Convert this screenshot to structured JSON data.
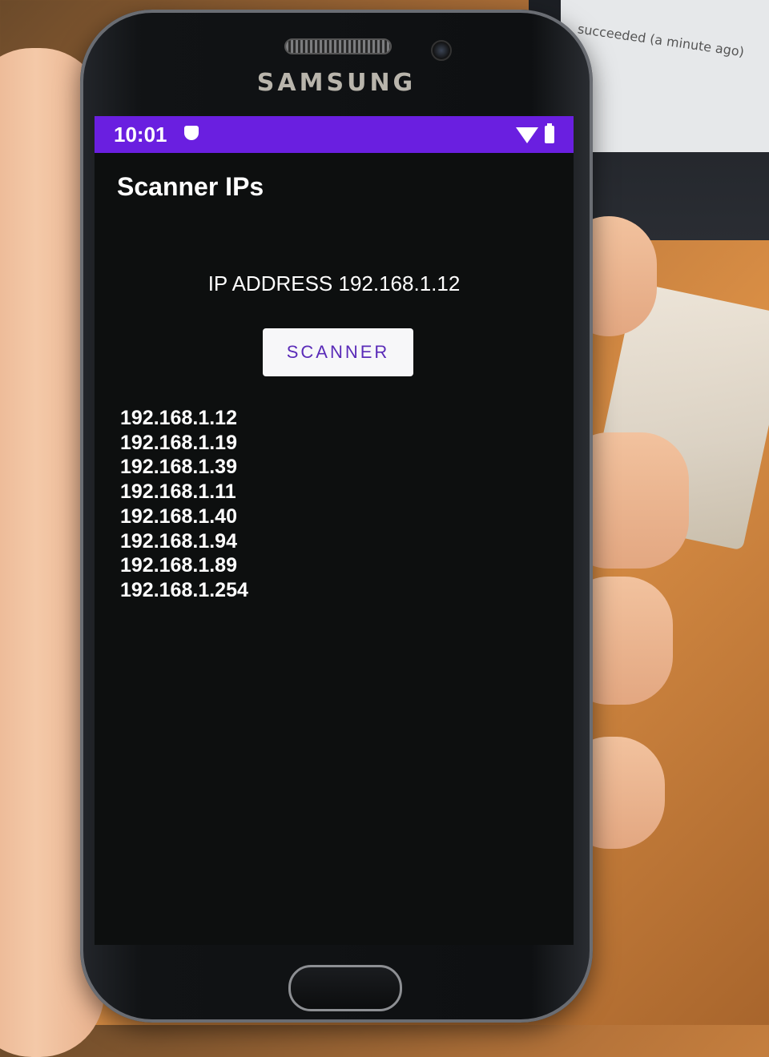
{
  "device": {
    "brand": "SAMSUNG"
  },
  "status_bar": {
    "time": "10:01",
    "accent_color": "#6a1fe0"
  },
  "app": {
    "title": "Scanner IPs",
    "ip_address_line": "IP ADDRESS 192.168.1.12",
    "scan_button_label": "SCANNER",
    "found_ips": [
      "192.168.1.12",
      "192.168.1.19",
      "192.168.1.39",
      "192.168.1.11",
      "192.168.1.40",
      "192.168.1.94",
      "192.168.1.89",
      "192.168.1.254"
    ]
  },
  "background": {
    "monitor_text": "succeeded (a minute ago)"
  }
}
